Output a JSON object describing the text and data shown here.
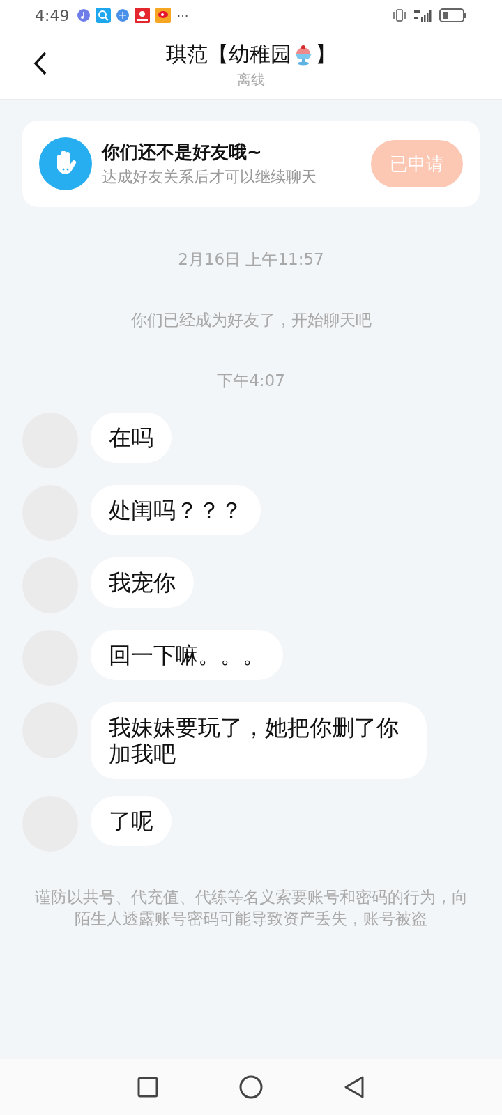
{
  "status_bar": {
    "time": "4:49",
    "more": "···"
  },
  "header": {
    "title_start": "琪范【幼稚园",
    "title_end": "】",
    "subtitle": "离线"
  },
  "friend_card": {
    "title": "你们还不是好友哦~",
    "subtitle": "达成好友关系后才可以继续聊天",
    "button": "已申请"
  },
  "timeline": [
    {
      "kind": "timestamp",
      "text": "2月16日 上午11:57"
    },
    {
      "kind": "system",
      "text": "你们已经成为好友了，开始聊天吧"
    },
    {
      "kind": "timestamp",
      "text": "下午4:07"
    },
    {
      "kind": "message",
      "text": "在吗"
    },
    {
      "kind": "message",
      "text": "处闺吗？？？"
    },
    {
      "kind": "message",
      "text": "我宠你"
    },
    {
      "kind": "message",
      "text": "回一下嘛。。。"
    },
    {
      "kind": "message",
      "text": "我妹妹要玩了，她把你删了你加我吧"
    },
    {
      "kind": "message",
      "text": "了呢"
    }
  ],
  "warning": "谨防以共号、代充值、代练等名义索要账号和密码的行为，向陌生人透露账号密码可能导致资产丢失，账号被盗"
}
